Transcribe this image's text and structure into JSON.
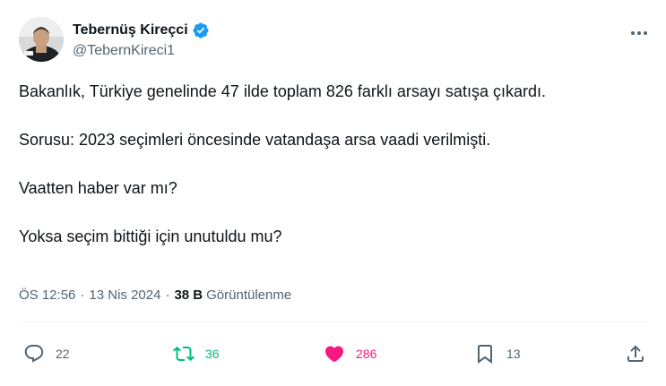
{
  "author": {
    "display_name": "Tebernüş Kireçci",
    "handle": "@TebernKireci1",
    "verified": true
  },
  "tweet": {
    "lines": [
      "Bakanlık, Türkiye genelinde 47 ilde toplam 826 farklı arsayı satışa çıkardı.",
      "Sorusu: 2023 seçimleri öncesinde vatandaşa arsa vaadi verilmişti.",
      "Vaatten haber var mı?",
      "Yoksa seçim bittiği için unutuldu mu?"
    ]
  },
  "meta": {
    "time": "ÖS 12:56",
    "separator": "·",
    "date": "13 Nis 2024",
    "views_count": "38 B",
    "views_label": "Görüntülenme"
  },
  "actions": {
    "replies": "22",
    "retweets": "36",
    "likes": "286",
    "bookmarks": "13"
  },
  "colors": {
    "text": "#0f1419",
    "secondary": "#536471",
    "verified": "#1d9bf0",
    "retweet": "#00ba7c",
    "like": "#f91880"
  },
  "icons": [
    "more-icon",
    "verified-badge-icon",
    "reply-icon",
    "retweet-icon",
    "heart-icon",
    "bookmark-icon",
    "share-icon"
  ]
}
